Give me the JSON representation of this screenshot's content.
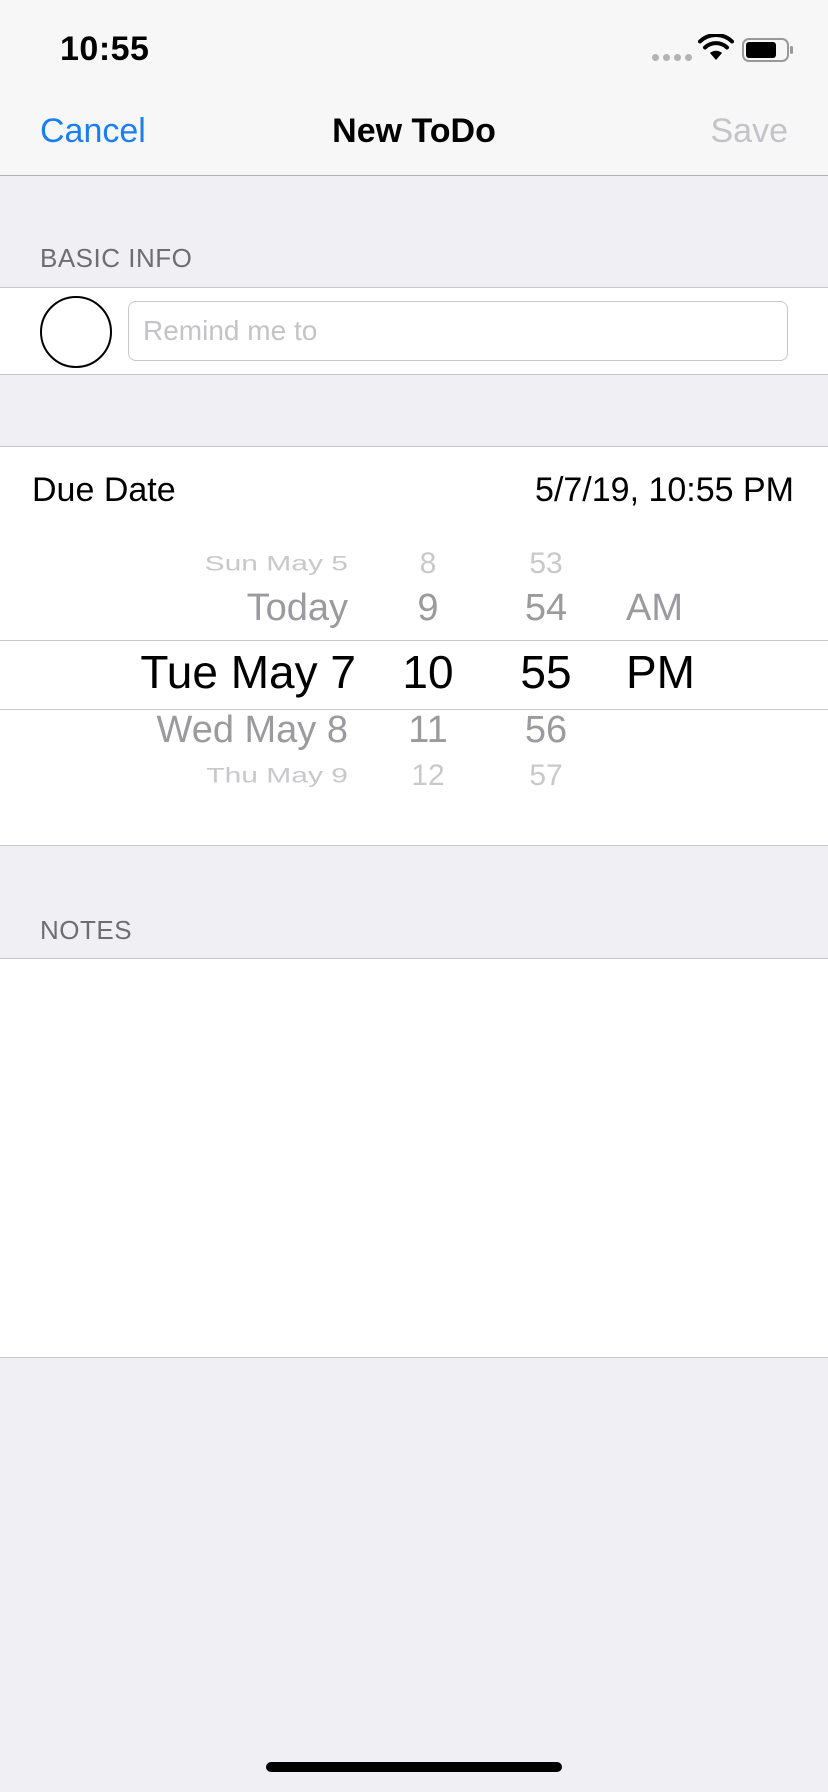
{
  "status_bar": {
    "time": "10:55"
  },
  "nav": {
    "cancel_label": "Cancel",
    "title": "New ToDo",
    "save_label": "Save"
  },
  "basic_info": {
    "header": "BASIC INFO",
    "remind_placeholder": "Remind me to",
    "remind_value": ""
  },
  "due_date": {
    "label": "Due Date",
    "value": "5/7/19, 10:55 PM",
    "picker": {
      "dates": [
        "Sun May 5",
        "Today",
        "Tue May 7",
        "Wed May 8",
        "Thu May 9"
      ],
      "hours": [
        "8",
        "9",
        "10",
        "11",
        "12"
      ],
      "minutes": [
        "53",
        "54",
        "55",
        "56",
        "57"
      ],
      "ampm": [
        "AM",
        "PM"
      ]
    }
  },
  "notes": {
    "header": "NOTES",
    "value": ""
  },
  "colors": {
    "accent": "#1a7ff0",
    "disabled": "#c4c4c8",
    "background": "#efeff4"
  }
}
